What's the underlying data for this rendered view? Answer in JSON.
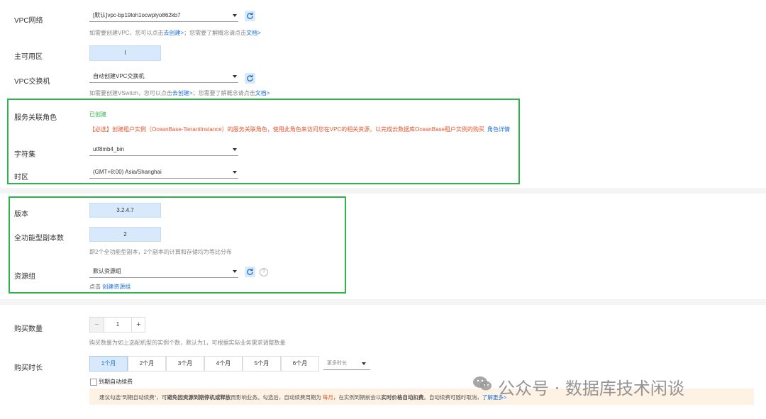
{
  "vpc": {
    "label": "VPC网络",
    "value": "[默认]vpc-bp19loh1ocwplyo862kb7",
    "hint_prefix": "如需要创建VPC，您可以点击",
    "hint_link1": "去创建>",
    "hint_mid": "；您需要了解概念请点击",
    "hint_link2": "文档>"
  },
  "zone": {
    "label": "主可用区",
    "value": "I"
  },
  "vswitch": {
    "label": "VPC交换机",
    "value": "自动创建VPC交换机",
    "hint_prefix": "如需要创建VSwitch，您可以点击",
    "hint_link1": "去创建>",
    "hint_mid": "；您需要了解概念请点击",
    "hint_link2": "文档>"
  },
  "service_role": {
    "label": "服务关联角色",
    "status": "已创建",
    "warning": "【必选】创建租户实例（OceanBase-TenantInstance）的服务关联角色，使用此角色来访问您在VPC的相关资源，以完成云数据库OceanBase租户实例的购买",
    "link": "角色详情"
  },
  "charset": {
    "label": "字符集",
    "value": "utf8mb4_bin"
  },
  "timezone": {
    "label": "时区",
    "value": "(GMT+8:00) Asia/Shanghai"
  },
  "version": {
    "label": "版本",
    "value": "3.2.4.7"
  },
  "replicas": {
    "label": "全功能型副本数",
    "value": "2",
    "hint": "即2个全功能型副本，2个副本的计算和存储均为等比分布"
  },
  "resource_group": {
    "label": "资源组",
    "value": "默认资源组",
    "hint_prefix": "点击",
    "hint_link": "创建资源组"
  },
  "quantity": {
    "label": "购买数量",
    "value": "1",
    "minus": "−",
    "plus": "+",
    "hint": "购买数量为如上选配机型的实例个数，默认为1，可根据实际业务需求调整数量"
  },
  "duration": {
    "label": "购买时长",
    "options": [
      "1个月",
      "2个月",
      "3个月",
      "4个月",
      "5个月",
      "6个月"
    ],
    "selected_index": 0,
    "more": "更多时长"
  },
  "auto_renew": {
    "label": "到期自动续费",
    "tip_a": "建议勾选\"到期自动续费\"，可",
    "tip_b": "避免因资源到期停机或释放",
    "tip_c": "而影响业务。勾选后，自动续费周期为",
    "tip_d": "每月",
    "tip_e": "，在实例到期前会以",
    "tip_f": "实时价格自动扣费",
    "tip_g": "。自动续费可随时取消，",
    "tip_link": "了解更多>"
  },
  "watermark": {
    "text": "公众号 · 数据库技术闲谈"
  },
  "colors": {
    "green_frame": "#2fb44a",
    "link": "#1a6fd6",
    "selected_bg": "#d7e9fb"
  }
}
